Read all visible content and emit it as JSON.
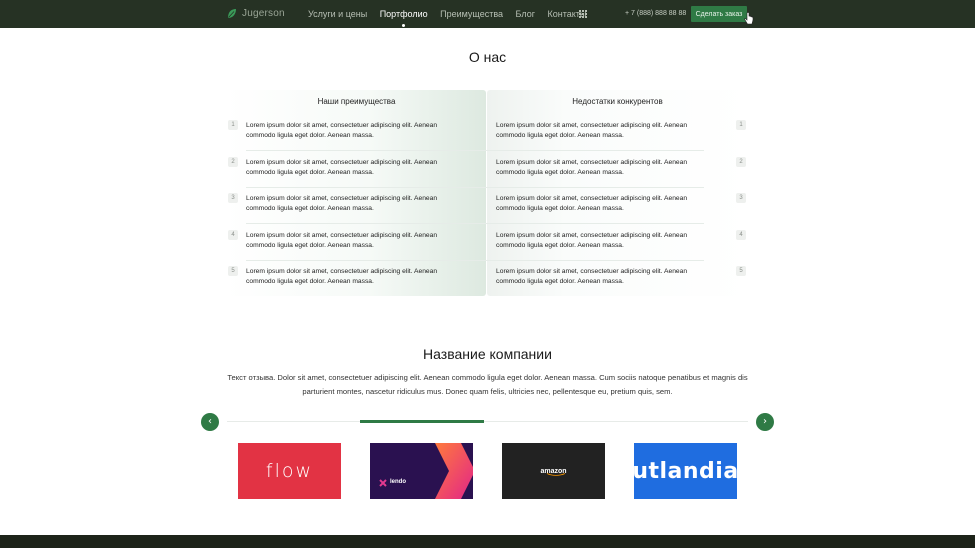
{
  "navbar": {
    "logo_text": "Jugerson",
    "links": [
      "Услуги и цены",
      "Портфолио",
      "Преимущества",
      "Блог",
      "Контакты"
    ],
    "active_link": "Портфолио",
    "phone": "+ 7 (888) 888 88 88",
    "cta_label": "Сделать заказ",
    "icons": [
      "leaf-logo-icon",
      "apps-grid-icon",
      "cursor-icon"
    ]
  },
  "about": {
    "title": "О нас",
    "left_header": "Наши преимущества",
    "right_header": "Недостатки конкурентов",
    "rows": [
      {
        "num": "1",
        "left": "Lorem ipsum dolor sit amet, consectetuer adipiscing elit. Aenean commodo ligula eget dolor. Aenean massa.",
        "right": "Lorem ipsum dolor sit amet, consectetuer adipiscing elit. Aenean commodo ligula eget dolor. Aenean massa."
      },
      {
        "num": "2",
        "left": "Lorem ipsum dolor sit amet, consectetuer adipiscing elit. Aenean commodo ligula eget dolor. Aenean massa.",
        "right": "Lorem ipsum dolor sit amet, consectetuer adipiscing elit. Aenean commodo ligula eget dolor. Aenean massa."
      },
      {
        "num": "3",
        "left": "Lorem ipsum dolor sit amet, consectetuer adipiscing elit. Aenean commodo ligula eget dolor. Aenean massa.",
        "right": "Lorem ipsum dolor sit amet, consectetuer adipiscing elit. Aenean commodo ligula eget dolor. Aenean massa."
      },
      {
        "num": "4",
        "left": "Lorem ipsum dolor sit amet, consectetuer adipiscing elit. Aenean commodo ligula eget dolor. Aenean massa.",
        "right": "Lorem ipsum dolor sit amet, consectetuer adipiscing elit. Aenean commodo ligula eget dolor. Aenean massa."
      },
      {
        "num": "5",
        "left": "Lorem ipsum dolor sit amet, consectetuer adipiscing elit. Aenean commodo ligula eget dolor. Aenean massa.",
        "right": "Lorem ipsum dolor sit amet, consectetuer adipiscing elit. Aenean commodo ligula eget dolor. Aenean massa."
      }
    ]
  },
  "review": {
    "title": "Название компании",
    "text": "Текст отзыва. Dolor sit amet, consectetuer adipiscing elit. Aenean commodo ligula eget dolor. Aenean massa. Cum sociis natoque penatibus et magnis dis parturient montes, nascetur ridiculus mus. Donec quam felis, ultricies nec, pellentesque eu, pretium quis, sem.",
    "prev_label": "‹",
    "next_label": "›",
    "active_slide": 2,
    "logos": [
      {
        "name": "flow",
        "label": "flow",
        "color": "#e23344"
      },
      {
        "name": "lendo",
        "label": "lendo",
        "color": "#2a1150"
      },
      {
        "name": "amazon",
        "label": "amazon",
        "color": "#222222"
      },
      {
        "name": "utlandia",
        "label": "utlandia",
        "color": "#1f6de0"
      }
    ]
  },
  "colors": {
    "nav_bg": "#263224",
    "accent_green": "#2f7a45",
    "text": "#222222"
  }
}
